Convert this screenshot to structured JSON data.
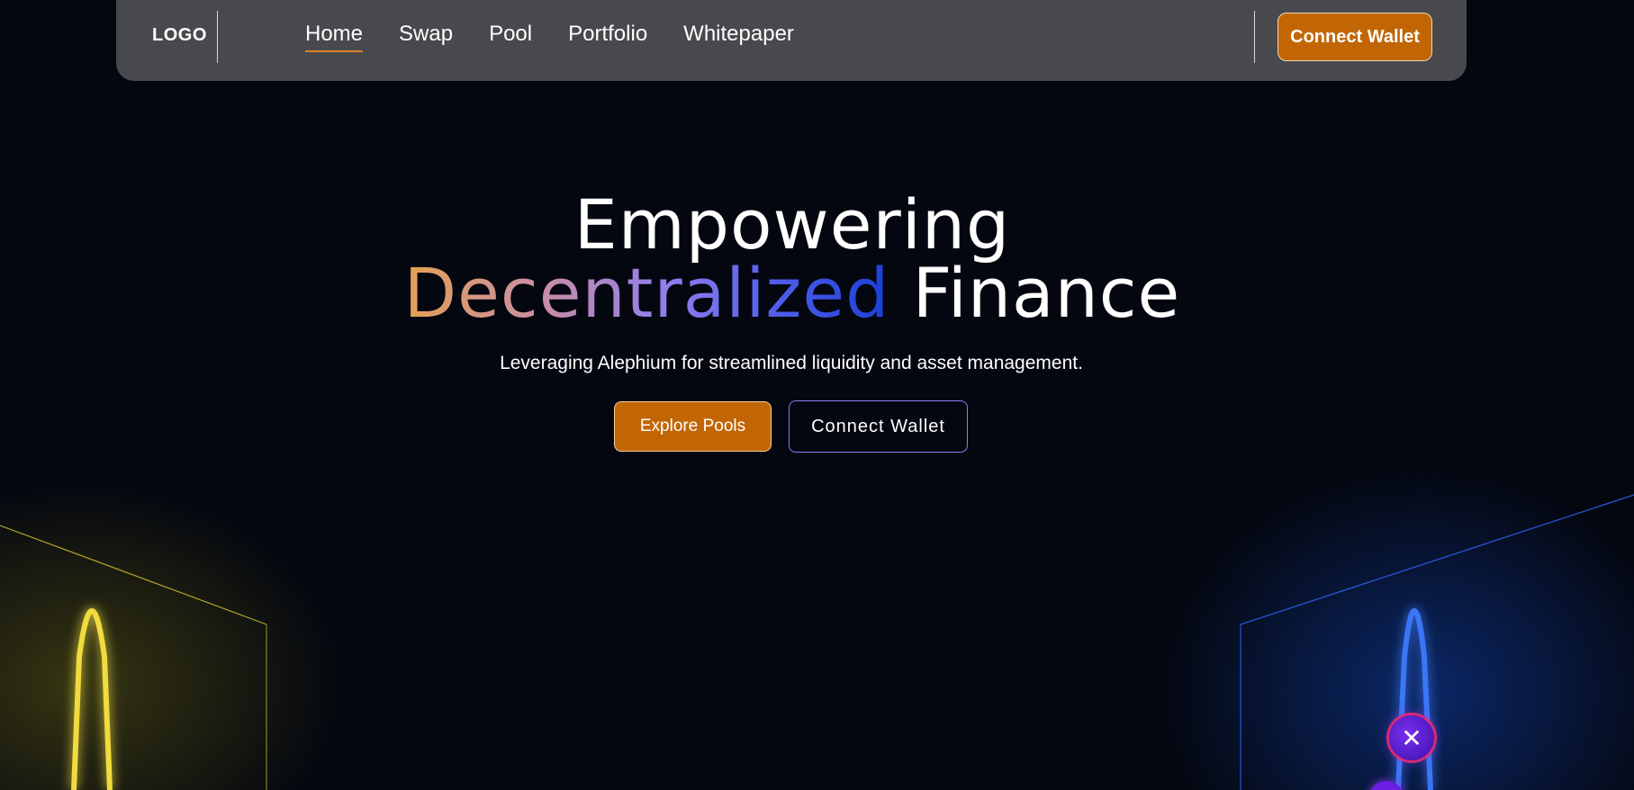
{
  "navbar": {
    "logo": "LOGO",
    "links": [
      {
        "label": "Home",
        "active": true
      },
      {
        "label": "Swap",
        "active": false
      },
      {
        "label": "Pool",
        "active": false
      },
      {
        "label": "Portfolio",
        "active": false
      },
      {
        "label": "Whitepaper",
        "active": false
      }
    ],
    "connect_label": "Connect Wallet"
  },
  "hero": {
    "title_line1": "Empowering",
    "title_highlight": "Decentralized",
    "title_rest": "Finance",
    "subtitle": "Leveraging Alephium for streamlined liquidity and asset management.",
    "primary_button": "Explore Pools",
    "secondary_button": "Connect Wallet"
  },
  "decor": {
    "token_symbol": "✕",
    "icons": [
      "neon-arch-left",
      "neon-arch-right",
      "token-icon"
    ]
  },
  "colors": {
    "accent": "#c26605",
    "nav_bg": "#48494d",
    "page_bg": "#040710",
    "gradient": [
      "#e3a052",
      "#c98ea6",
      "#8e7df0",
      "#4d5be8",
      "#1a3fd8"
    ],
    "left_glow": "#e8d43a",
    "right_glow": "#2f6cf0",
    "outline_button_border": "#8b7cf6"
  }
}
